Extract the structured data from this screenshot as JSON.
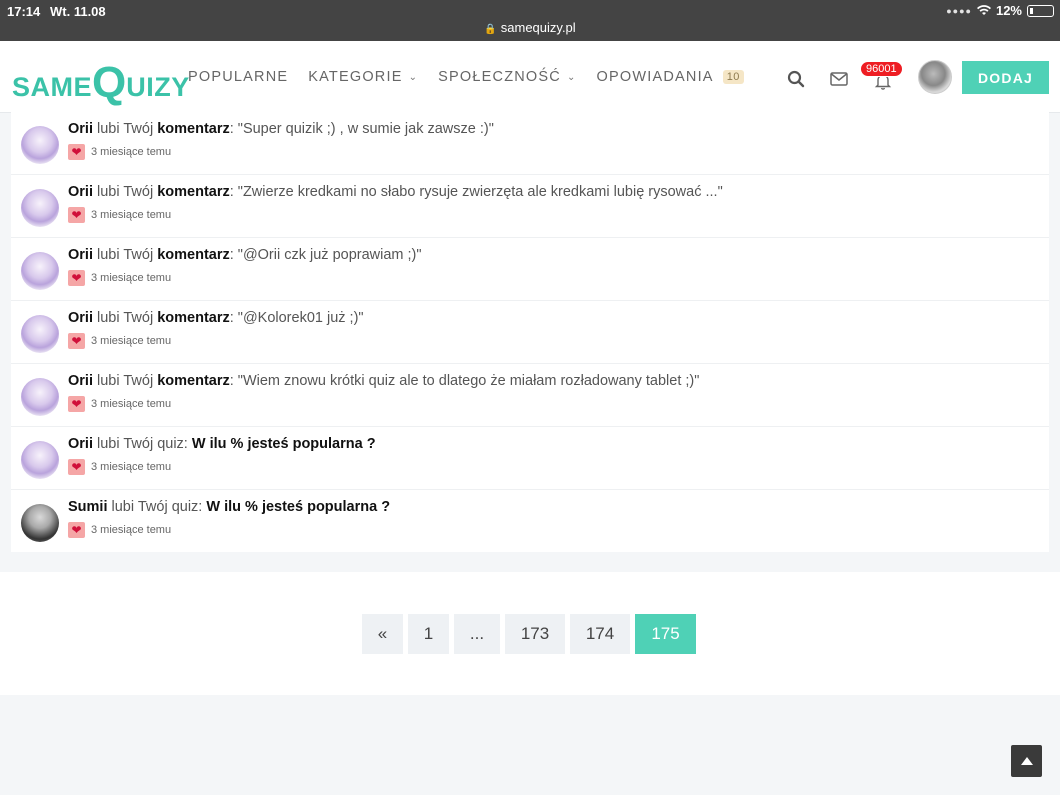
{
  "status_bar": {
    "time": "17:14",
    "date": "Wt. 11.08",
    "battery": "12%",
    "url": "samequizy.pl"
  },
  "header": {
    "logo": "sameQuizy",
    "nav": [
      {
        "label": "POPULARNE"
      },
      {
        "label": "KATEGORIE",
        "dropdown": true
      },
      {
        "label": "SPOŁECZNOŚĆ",
        "dropdown": true
      },
      {
        "label": "OPOWIADANIA",
        "badge": "10"
      }
    ],
    "notifications_count": "96001",
    "add_button": "DODAJ",
    "icons": [
      "search-icon",
      "mail-icon",
      "bell-icon",
      "avatar"
    ]
  },
  "notifications": [
    {
      "user": "Orii",
      "action": "lubi Twój",
      "target": "komentarz",
      "content": ": \"Super quizik ;) , w sumie jak zawsze :)\"",
      "time": "3 miesiące temu"
    },
    {
      "user": "Orii",
      "action": "lubi Twój",
      "target": "komentarz",
      "content": ": \"Zwierze kredkami no słabo rysuje zwierzęta ale kredkami lubię rysować ...\"",
      "time": "3 miesiące temu"
    },
    {
      "user": "Orii",
      "action": "lubi Twój",
      "target": "komentarz",
      "content": ": \"@Orii czk już poprawiam ;)\"",
      "time": "3 miesiące temu"
    },
    {
      "user": "Orii",
      "action": "lubi Twój",
      "target": "komentarz",
      "content": ": \"@Kolorek01 już ;)\"",
      "time": "3 miesiące temu"
    },
    {
      "user": "Orii",
      "action": "lubi Twój",
      "target": "komentarz",
      "content": ": \"Wiem znowu krótki quiz ale to dlatego że miałam rozładowany tablet ;)\"",
      "time": "3 miesiące temu"
    },
    {
      "user": "Orii",
      "action": "lubi Twój quiz:",
      "target": "W ilu % jesteś popularna ?",
      "content": "",
      "time": "3 miesiące temu"
    },
    {
      "user": "Sumii",
      "action": "lubi Twój quiz:",
      "target": "W ilu % jesteś popularna ?",
      "content": "",
      "time": "3 miesiące temu"
    }
  ],
  "pagination": {
    "items": [
      {
        "label": "«",
        "active": false
      },
      {
        "label": "1",
        "active": false
      },
      {
        "label": "...",
        "active": false
      },
      {
        "label": "173",
        "active": false
      },
      {
        "label": "174",
        "active": false
      },
      {
        "label": "175",
        "active": true
      }
    ]
  },
  "colors": {
    "accent": "#4fd1b6",
    "badge_red": "#ee1d23",
    "heart": "#d0103a"
  }
}
